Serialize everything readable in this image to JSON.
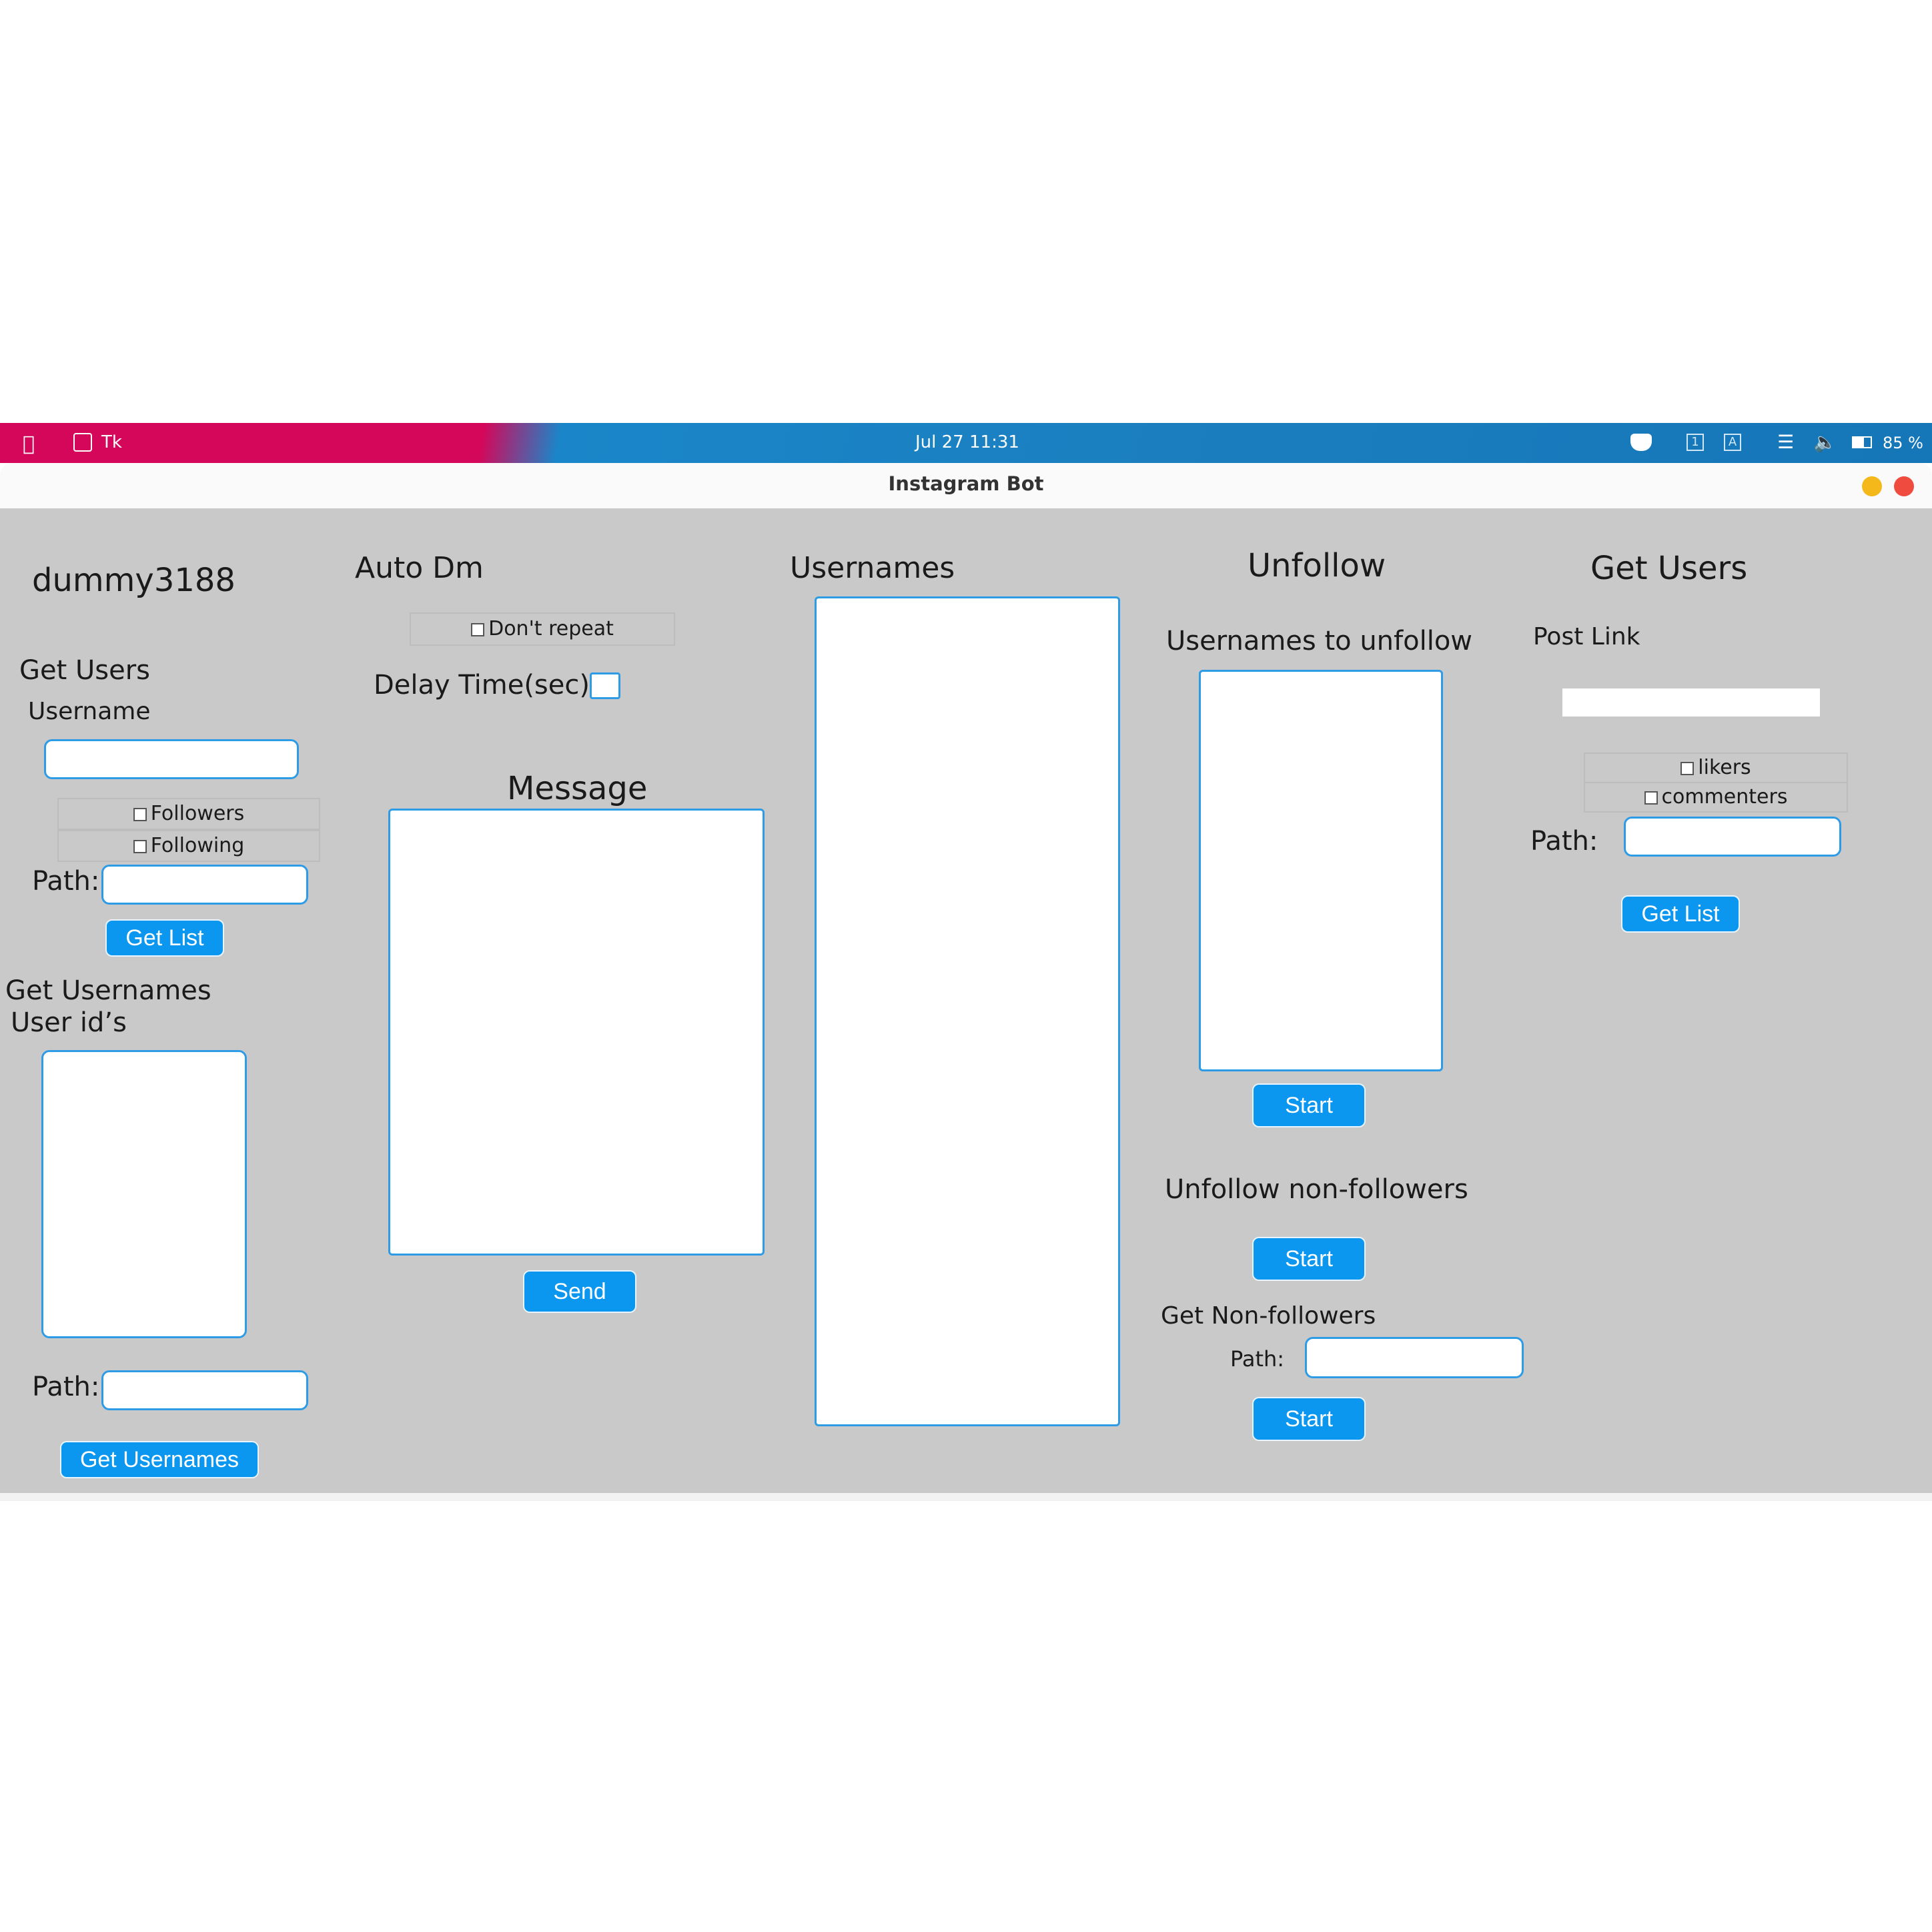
{
  "system_bar": {
    "app_name": "Tk",
    "clock": "Jul 27  11:31",
    "battery": "85 %"
  },
  "window": {
    "title": "Instagram Bot"
  },
  "col1": {
    "account": "dummy3188",
    "get_users_title": "Get Users",
    "username_label": "Username",
    "username_value": "",
    "followers_label": "Followers",
    "followers_checked": false,
    "following_label": "Following",
    "following_checked": false,
    "path_label": "Path:",
    "path_value": "",
    "get_list_button": "Get List",
    "get_usernames_title": "Get Usernames",
    "user_ids_label": "User id’s",
    "path2_label": "Path:",
    "path2_value": "",
    "get_usernames_button": "Get Usernames"
  },
  "col2": {
    "title": "Auto Dm",
    "dont_repeat_label": "Don't repeat",
    "dont_repeat_checked": false,
    "delay_label": "Delay Time(sec):",
    "delay_value": "",
    "message_label": "Message",
    "send_button": "Send"
  },
  "col3": {
    "title": "Usernames"
  },
  "col4": {
    "title": "Unfollow",
    "usernames_to_unfollow_label": "Usernames to unfollow",
    "start_button_1": "Start",
    "unfollow_non_followers_label": "Unfollow non-followers",
    "start_button_2": "Start",
    "get_non_followers_label": "Get Non-followers",
    "path_label": "Path:",
    "path_value": "",
    "start_button_3": "Start"
  },
  "col5": {
    "title": "Get Users",
    "post_link_label": "Post Link",
    "post_link_value": "",
    "likers_label": "likers",
    "likers_checked": false,
    "commenters_label": "commenters",
    "commenters_checked": false,
    "path_label": "Path:",
    "path_value": "",
    "get_list_button": "Get List"
  },
  "colors": {
    "accent": "#0b96f0",
    "panel_bg": "#c9c9c9",
    "topbar_pink": "#d4075a",
    "topbar_blue": "#1a86c9",
    "close_button": "#ef4b3f",
    "minimize_button": "#f5b81a"
  }
}
